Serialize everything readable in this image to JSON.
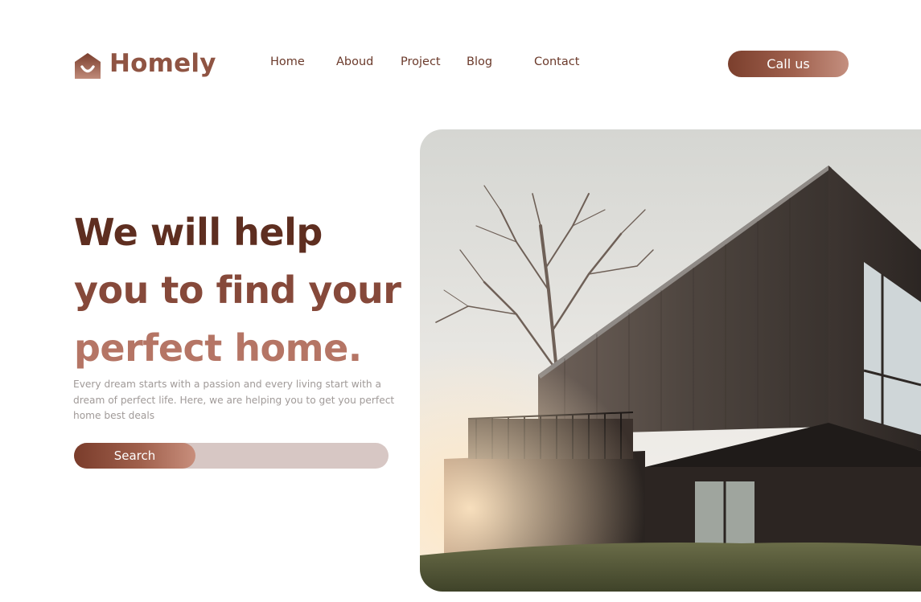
{
  "brand": {
    "name": "Homely",
    "icon": "house-smile-icon"
  },
  "nav": {
    "items": [
      "Home",
      "Aboud",
      "Project",
      "Blog",
      "Contact"
    ]
  },
  "cta": {
    "label": "Call us"
  },
  "hero": {
    "line1": "We will help",
    "line2": "you to find your",
    "line3": "perfect home.",
    "subtitle": "Every dream starts with a passion and every living start with a dream of perfect life. Here, we are helping you to get you perfect home best deals"
  },
  "search": {
    "button_label": "Search",
    "placeholder": "",
    "value": ""
  },
  "colors": {
    "brand_dark": "#5e2e20",
    "brand_mid": "#86493a",
    "brand_light": "#b57565",
    "search_track": "#d7c7c4"
  }
}
